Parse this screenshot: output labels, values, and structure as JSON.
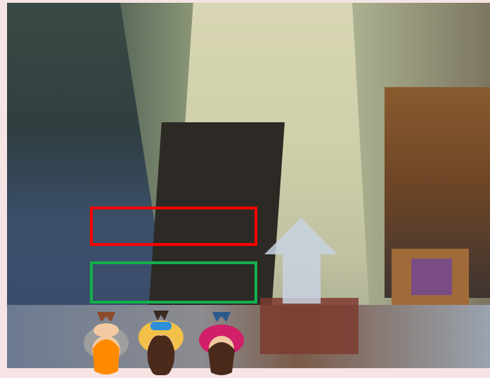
{
  "scene": {
    "type": "top-down room view",
    "highlight_boxes": [
      {
        "name": "red-target-box",
        "color": "#ff0000"
      },
      {
        "name": "green-target-box",
        "color": "#12b14b"
      }
    ],
    "direction_arrow": {
      "icon": "up-arrow-icon",
      "color": "#c8d2e1"
    },
    "avatars": [
      {
        "name": "avatar-orange-hair",
        "hair_color": "#ff8a00",
        "shirt_color": "#9e9e9e"
      },
      {
        "name": "avatar-brown-curly-hair",
        "hair_color": "#4a2a1a",
        "shirt_color": "#2e8fd8"
      },
      {
        "name": "avatar-brown-hair",
        "hair_color": "#4a2a1a",
        "shirt_color": "#d11f6a"
      }
    ]
  }
}
